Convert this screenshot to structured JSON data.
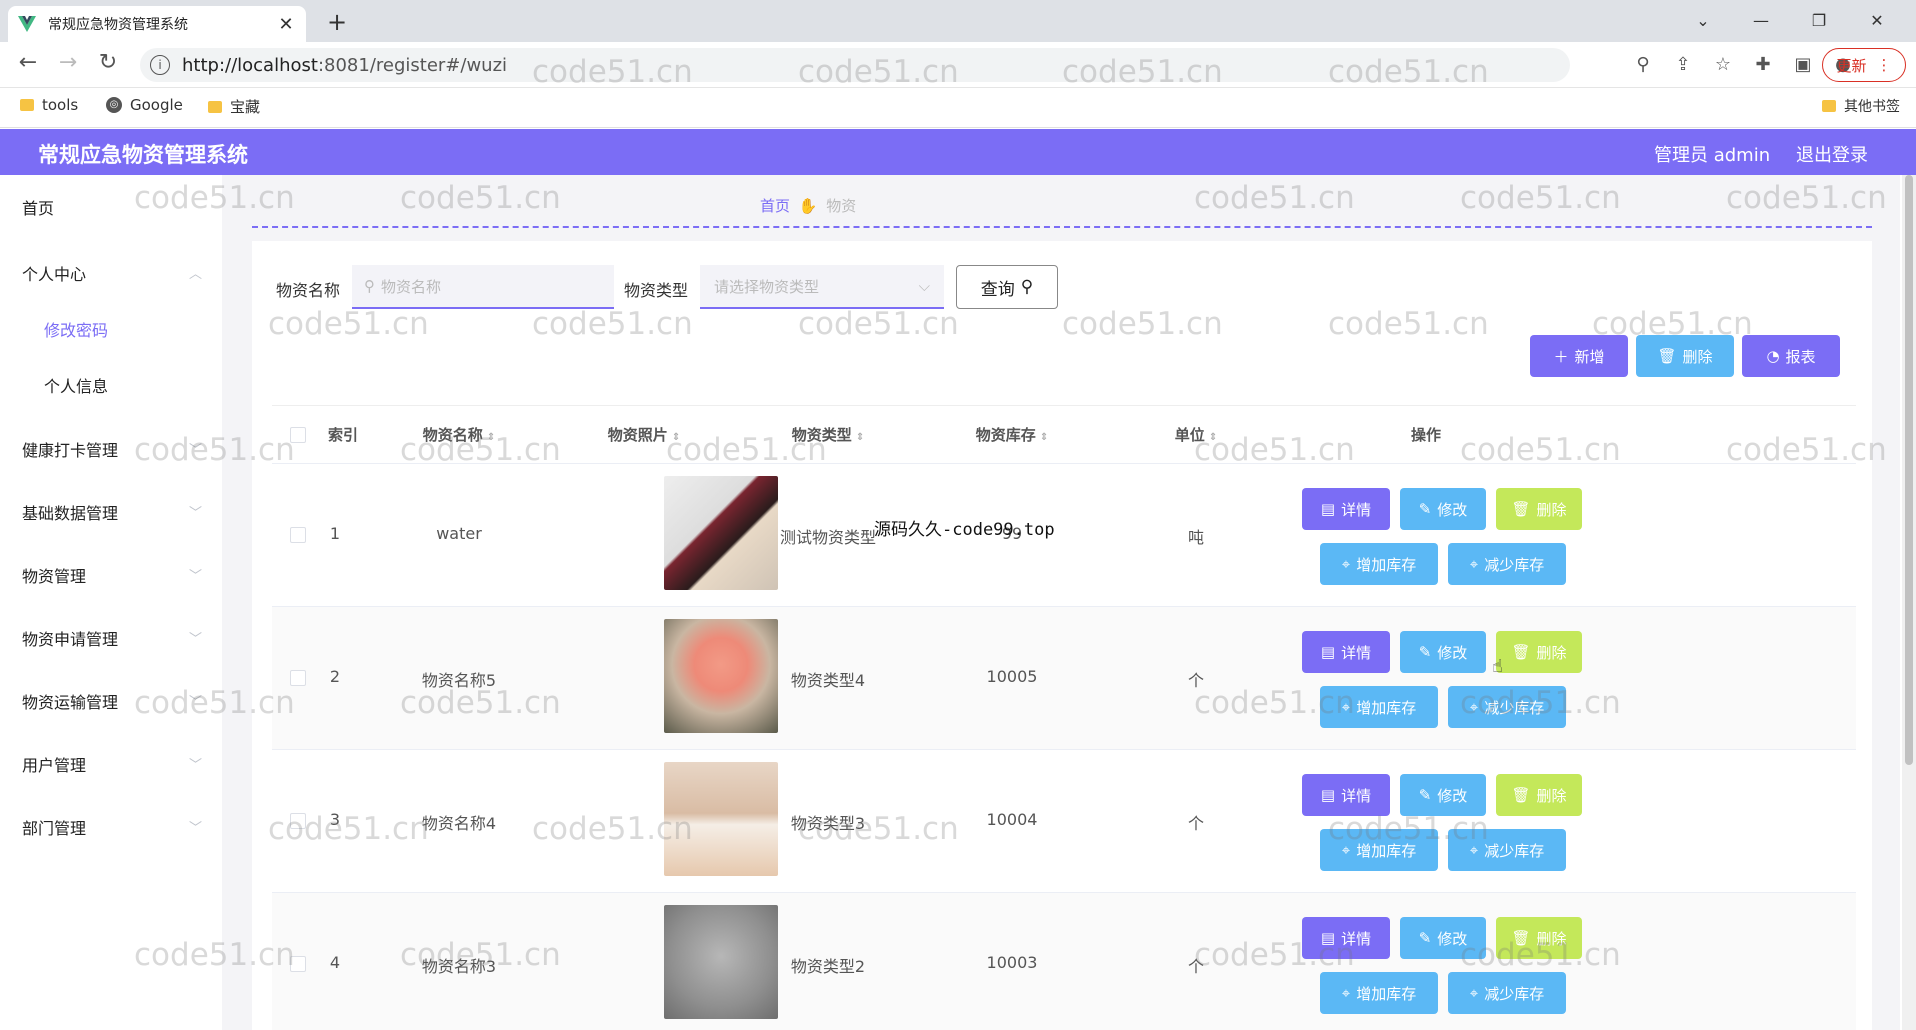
{
  "browser": {
    "tab_title": "常规应急物资管理系统",
    "url_host": "http://localhost",
    "url_path": ":8081/register#/wuzi",
    "update_label": "更新",
    "bookmarks": [
      "tools",
      "Google",
      "宝藏"
    ],
    "other_bookmarks": "其他书签"
  },
  "app": {
    "title": "常规应急物资管理系统",
    "user": "管理员 admin",
    "logout": "退出登录"
  },
  "sidebar": {
    "items": [
      {
        "label": "首页"
      },
      {
        "label": "个人中心"
      },
      {
        "label": "修改密码"
      },
      {
        "label": "个人信息"
      },
      {
        "label": "健康打卡管理"
      },
      {
        "label": "基础数据管理"
      },
      {
        "label": "物资管理"
      },
      {
        "label": "物资申请管理"
      },
      {
        "label": "物资运输管理"
      },
      {
        "label": "用户管理"
      },
      {
        "label": "部门管理"
      }
    ]
  },
  "breadcrumb": {
    "home": "首页",
    "current": "物资"
  },
  "search": {
    "name_label": "物资名称",
    "name_placeholder": "物资名称",
    "type_label": "物资类型",
    "type_placeholder": "请选择物资类型",
    "query_label": "查询"
  },
  "actions": {
    "add": "新增",
    "delete": "删除",
    "report": "报表"
  },
  "table": {
    "headers": [
      "索引",
      "物资名称",
      "物资照片",
      "物资类型",
      "物资库存",
      "单位",
      "操作"
    ],
    "rows": [
      {
        "index": "1",
        "name": "water",
        "type": "测试物资类型",
        "stock": "99",
        "unit": "吨",
        "image": "anime-girls-photo"
      },
      {
        "index": "2",
        "name": "物资名称5",
        "type": "物资类型4",
        "stock": "10005",
        "unit": "个",
        "image": "pink-flowers-photo"
      },
      {
        "index": "3",
        "name": "物资名称4",
        "type": "物资类型3",
        "stock": "10004",
        "unit": "个",
        "image": "stationery-box-photo"
      },
      {
        "index": "4",
        "name": "物资名称3",
        "type": "物资类型2",
        "stock": "10003",
        "unit": "个",
        "image": "hairpin-photo"
      }
    ],
    "row_buttons": {
      "detail": "详情",
      "edit": "修改",
      "delete": "删除",
      "add_stock": "增加库存",
      "reduce_stock": "减少库存"
    }
  },
  "overlay_text": "源码久久-code99.top",
  "watermark": "code51.cn",
  "colors": {
    "primary": "#7b6df5",
    "info": "#5bb8f5",
    "warn": "#c4e85a"
  }
}
